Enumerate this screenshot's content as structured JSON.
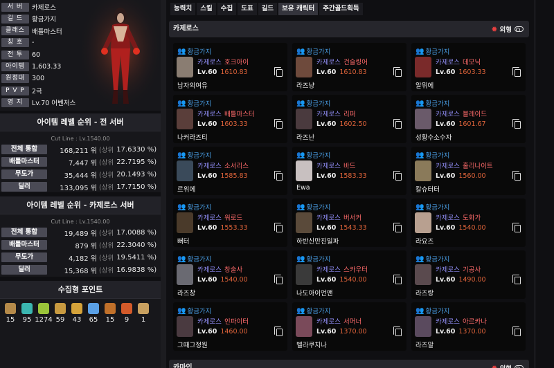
{
  "profile": {
    "rows": [
      {
        "label": "서 버",
        "value": "카제로스"
      },
      {
        "label": "길 드",
        "value": "황금가지"
      },
      {
        "label": "클래스",
        "value": "배틀마스터"
      },
      {
        "label": "칭 호",
        "value": "-"
      },
      {
        "label": "전 투",
        "value": "60"
      },
      {
        "label": "아이템",
        "value": "1,603.33"
      },
      {
        "label": "원정대",
        "value": "300"
      },
      {
        "label": "P V P",
        "value": "2극"
      },
      {
        "label": "영 지",
        "value": "Lv.70 어벤저스"
      }
    ]
  },
  "rank_all": {
    "title": "아이템 레벨 순위 - 전 서버",
    "cutline": "Cut Line : Lv.1540.00",
    "rows": [
      {
        "label": "전체 통합",
        "rank": "168,211 위",
        "sang": "(상위",
        "pct": "17.6330 %)"
      },
      {
        "label": "배틀마스터",
        "rank": "7,447 위",
        "sang": "(상위",
        "pct": "22.7195 %)"
      },
      {
        "label": "무도가",
        "rank": "35,444 위",
        "sang": "(상위",
        "pct": "20.1493 %)"
      },
      {
        "label": "딜러",
        "rank": "133,095 위",
        "sang": "(상위",
        "pct": "17.7150 %)"
      }
    ]
  },
  "rank_server": {
    "title": "아이템 레벨 순위 - 카제로스 서버",
    "cutline": "Cut Line : Lv.1540.00",
    "rows": [
      {
        "label": "전체 통합",
        "rank": "19,489 위",
        "sang": "(상위",
        "pct": "17.0088 %)"
      },
      {
        "label": "배틀마스터",
        "rank": "879 위",
        "sang": "(상위",
        "pct": "22.3040 %)"
      },
      {
        "label": "무도가",
        "rank": "4,182 위",
        "sang": "(상위",
        "pct": "19.5411 %)"
      },
      {
        "label": "딜러",
        "rank": "15,368 위",
        "sang": "(상위",
        "pct": "16.9838 %)"
      }
    ]
  },
  "collect": {
    "title": "수집형 포인트",
    "items": [
      {
        "icon": "mokoko-seed-icon",
        "count": "15",
        "color": "#b58a4a"
      },
      {
        "icon": "island-heart-icon",
        "count": "95",
        "color": "#3bb6b0"
      },
      {
        "icon": "great-art-icon",
        "count": "1274",
        "color": "#9ac43a"
      },
      {
        "icon": "giants-heart-icon",
        "count": "59",
        "color": "#c89a40"
      },
      {
        "icon": "igneas-token-icon",
        "count": "43",
        "color": "#d4a23a"
      },
      {
        "icon": "orpheus-star-icon",
        "count": "65",
        "color": "#5aa0e6"
      },
      {
        "icon": "world-tree-leaf-icon",
        "count": "15",
        "color": "#c0702a"
      },
      {
        "icon": "voyage-memento-icon",
        "count": "9",
        "color": "#d35a2a"
      },
      {
        "icon": "sea-bounty-icon",
        "count": "1",
        "color": "#c8a060"
      }
    ]
  },
  "tabs": [
    {
      "label": "능력치",
      "active": false
    },
    {
      "label": "스킬",
      "active": false
    },
    {
      "label": "수집",
      "active": false
    },
    {
      "label": "도표",
      "active": false
    },
    {
      "label": "길드",
      "active": false
    },
    {
      "label": "보유 캐릭터",
      "active": true
    },
    {
      "label": "주간골드획득",
      "active": false
    }
  ],
  "server_section": {
    "name": "카제로스",
    "toggle_label": "외형"
  },
  "characters": [
    {
      "guild": "황금가지",
      "server": "카제로스",
      "class": "호크아이",
      "lv": "Lv.60",
      "ilvl": "1610.83",
      "name": "남자의여유",
      "avatar": "#8a7d72"
    },
    {
      "guild": "황금가지",
      "server": "카제로스",
      "class": "건슬링어",
      "lv": "Lv.60",
      "ilvl": "1610.83",
      "name": "라즈냥",
      "avatar": "#6e4a3c"
    },
    {
      "guild": "황금가지",
      "server": "카제로스",
      "class": "데모닉",
      "lv": "Lv.60",
      "ilvl": "1603.33",
      "name": "알뮈에",
      "avatar": "#7a2a2a"
    },
    {
      "guild": "황금가지",
      "server": "카제로스",
      "class": "배틀마스터",
      "lv": "Lv.60",
      "ilvl": "1603.33",
      "name": "나커라즈티",
      "avatar": "#5a3e3a"
    },
    {
      "guild": "황금가지",
      "server": "카제로스",
      "class": "리퍼",
      "lv": "Lv.60",
      "ilvl": "1602.50",
      "name": "라즈난",
      "avatar": "#4a3a3e"
    },
    {
      "guild": "황금가지",
      "server": "카제로스",
      "class": "블레이드",
      "lv": "Lv.60",
      "ilvl": "1601.67",
      "name": "성황수소수자",
      "avatar": "#6a5a6a"
    },
    {
      "guild": "황금가지",
      "server": "카제로스",
      "class": "소서리스",
      "lv": "Lv.60",
      "ilvl": "1585.83",
      "name": "르위에",
      "avatar": "#3a4a5a"
    },
    {
      "guild": "황금가지",
      "server": "카제로스",
      "class": "바드",
      "lv": "Lv.60",
      "ilvl": "1583.33",
      "name": "Ewa",
      "avatar": "#c8c0c0"
    },
    {
      "guild": "황금가지",
      "server": "카제로스",
      "class": "홀리나이트",
      "lv": "Lv.60",
      "ilvl": "1560.00",
      "name": "칼슈터터",
      "avatar": "#8a7a5a"
    },
    {
      "guild": "황금가지",
      "server": "카제로스",
      "class": "워로드",
      "lv": "Lv.60",
      "ilvl": "1553.33",
      "name": "뻐터",
      "avatar": "#4a3a2a"
    },
    {
      "guild": "황금가지",
      "server": "카제로스",
      "class": "버서커",
      "lv": "Lv.60",
      "ilvl": "1543.33",
      "name": "하반신만진일파",
      "avatar": "#5a4a3a"
    },
    {
      "guild": "황금가지",
      "server": "카제로스",
      "class": "도화가",
      "lv": "Lv.60",
      "ilvl": "1540.00",
      "name": "라요즈",
      "avatar": "#b8a090"
    },
    {
      "guild": "황금가지",
      "server": "카제로스",
      "class": "창술사",
      "lv": "Lv.60",
      "ilvl": "1540.00",
      "name": "라즈창",
      "avatar": "#6a6a72"
    },
    {
      "guild": "황금가지",
      "server": "카제로스",
      "class": "스카우터",
      "lv": "Lv.60",
      "ilvl": "1540.00",
      "name": "나도아이언맨",
      "avatar": "#3a3a3a"
    },
    {
      "guild": "황금가지",
      "server": "카제로스",
      "class": "기공사",
      "lv": "Lv.60",
      "ilvl": "1490.00",
      "name": "라즈랑",
      "avatar": "#5a4a4e"
    },
    {
      "guild": "황금가지",
      "server": "카제로스",
      "class": "인파이터",
      "lv": "Lv.60",
      "ilvl": "1460.00",
      "name": "그때그정원",
      "avatar": "#4a3a40"
    },
    {
      "guild": "황금가지",
      "server": "카제로스",
      "class": "서머너",
      "lv": "Lv.60",
      "ilvl": "1370.00",
      "name": "벨라쿠치나",
      "avatar": "#7a4a5a"
    },
    {
      "guild": "황금가지",
      "server": "카제로스",
      "class": "아르카나",
      "lv": "Lv.60",
      "ilvl": "1370.00",
      "name": "라즈알",
      "avatar": "#5a4a5e"
    }
  ],
  "next_section": {
    "name": "카마인",
    "toggle_label": "외형"
  }
}
